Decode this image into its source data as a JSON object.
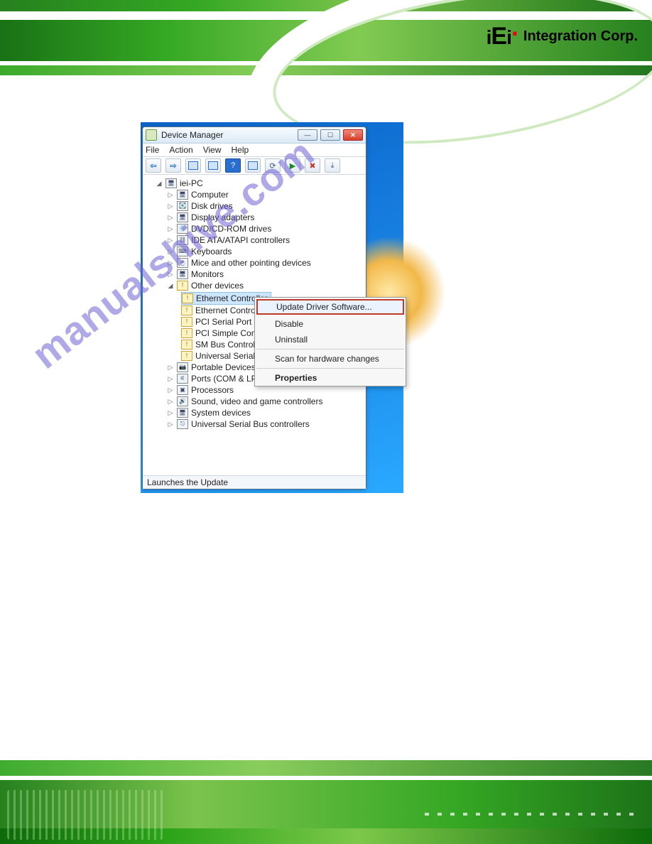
{
  "brand": {
    "logo": "iEi",
    "tag": "Integration Corp."
  },
  "watermark": "manualshive.com",
  "window": {
    "title": "Device Manager",
    "menu": [
      "File",
      "Action",
      "View",
      "Help"
    ],
    "status": "Launches the Update",
    "root": "iei-PC",
    "cats": [
      "Computer",
      "Disk drives",
      "Display adapters",
      "DVD/CD-ROM drives",
      "IDE ATA/ATAPI controllers",
      "Keyboards",
      "Mice and other pointing devices",
      "Monitors"
    ],
    "other_label": "Other devices",
    "other": [
      "Ethernet Controller",
      "Ethernet Control",
      "PCI Serial Port",
      "PCI Simple Comm",
      "SM Bus Controlle",
      "Universal Serial B"
    ],
    "cats2": [
      "Portable Devices",
      "Ports (COM & LPT)",
      "Processors",
      "Sound, video and game controllers",
      "System devices",
      "Universal Serial Bus controllers"
    ]
  },
  "ctx": {
    "update": "Update Driver Software...",
    "disable": "Disable",
    "uninstall": "Uninstall",
    "scan": "Scan for hardware changes",
    "props": "Properties"
  }
}
